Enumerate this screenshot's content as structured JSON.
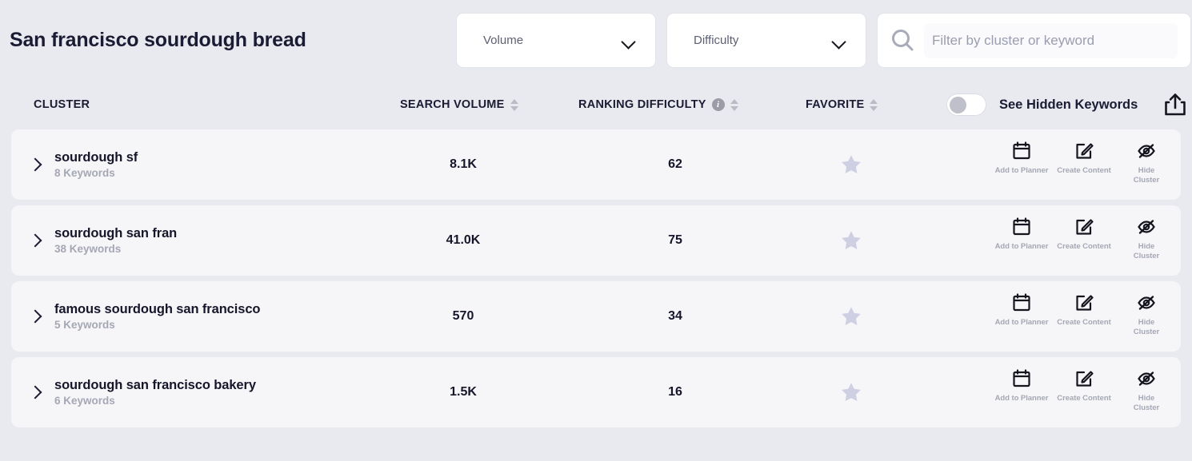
{
  "header": {
    "title": "San francisco sourdough bread",
    "filters": [
      {
        "label": "Volume",
        "icon": "chevron-down-icon"
      },
      {
        "label": "Difficulty",
        "icon": "chevron-down-icon"
      }
    ],
    "search": {
      "placeholder": "Filter by cluster or keyword",
      "value": "",
      "icon": "search-icon"
    }
  },
  "table": {
    "columns": {
      "cluster": "CLUSTER",
      "search_volume": "SEARCH VOLUME",
      "ranking_difficulty": "RANKING DIFFICULTY",
      "favorite": "FAVORITE"
    },
    "hidden_toggle": {
      "label": "See Hidden Keywords",
      "state": "off"
    },
    "export_icon": "export-upload-icon",
    "actions": [
      {
        "icon": "calendar-icon",
        "label": "Add to Planner"
      },
      {
        "icon": "edit-square-icon",
        "label": "Create Content"
      },
      {
        "icon": "eye-slash-icon",
        "label": "Hide Cluster"
      }
    ],
    "rows": [
      {
        "cluster": "sourdough sf",
        "keywords": "8 Keywords",
        "search_volume": "8.1K",
        "ranking_difficulty": "62",
        "favorite": "star-icon"
      },
      {
        "cluster": "sourdough san fran",
        "keywords": "38 Keywords",
        "search_volume": "41.0K",
        "ranking_difficulty": "75",
        "favorite": "star-icon"
      },
      {
        "cluster": "famous sourdough san francisco",
        "keywords": "5 Keywords",
        "search_volume": "570",
        "ranking_difficulty": "34",
        "favorite": "star-icon"
      },
      {
        "cluster": "sourdough san francisco bakery",
        "keywords": "6 Keywords",
        "search_volume": "1.5K",
        "ranking_difficulty": "16",
        "favorite": "star-icon"
      }
    ]
  },
  "colors": {
    "page_background": "#e9eaef",
    "row_background": "#f6f6f9",
    "text_primary": "#16162b",
    "text_muted": "#a5a7b4",
    "star": "#cfcfe3"
  }
}
